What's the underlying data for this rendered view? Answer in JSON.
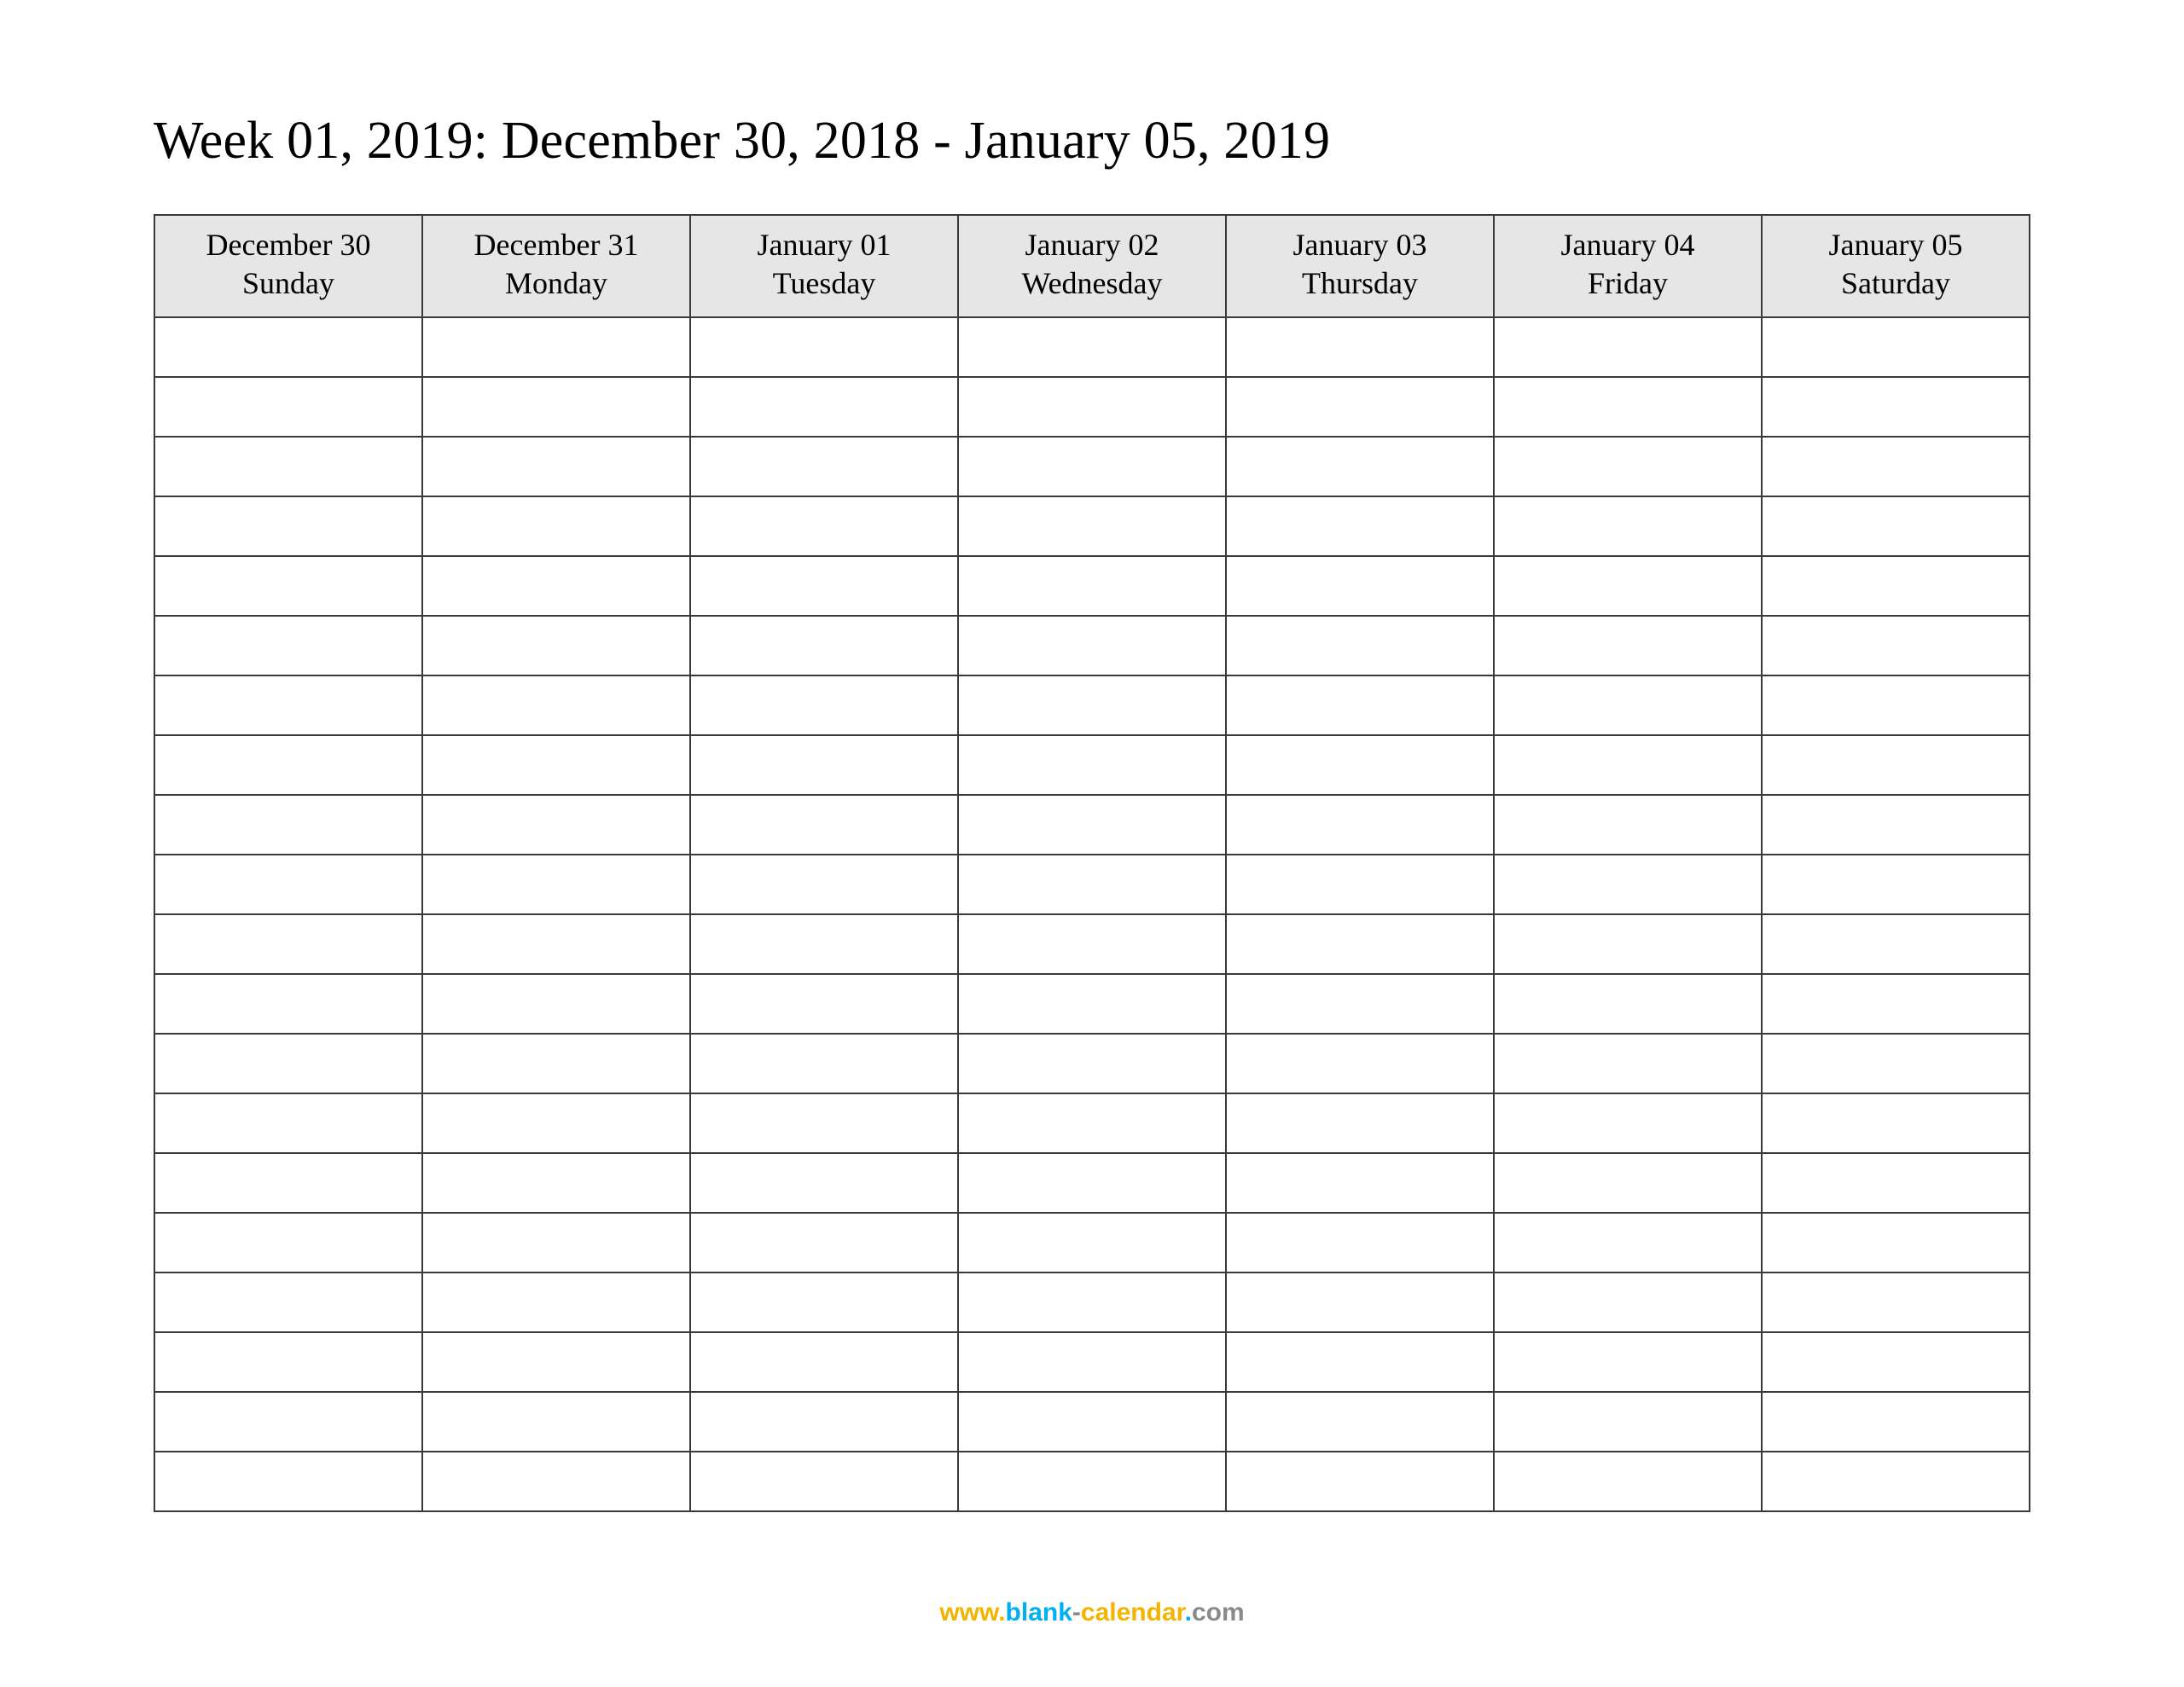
{
  "title": "Week 01, 2019: December 30, 2018 - January 05, 2019",
  "columns": [
    {
      "date": "December 30",
      "day": "Sunday"
    },
    {
      "date": "December 31",
      "day": "Monday"
    },
    {
      "date": "January 01",
      "day": "Tuesday"
    },
    {
      "date": "January 02",
      "day": "Wednesday"
    },
    {
      "date": "January 03",
      "day": "Thursday"
    },
    {
      "date": "January 04",
      "day": "Friday"
    },
    {
      "date": "January 05",
      "day": "Saturday"
    }
  ],
  "row_count": 20,
  "footer": {
    "www": "www.",
    "blank": "blank",
    "dash": "-",
    "calendar": "calendar",
    "dot": ".",
    "com": "com"
  }
}
